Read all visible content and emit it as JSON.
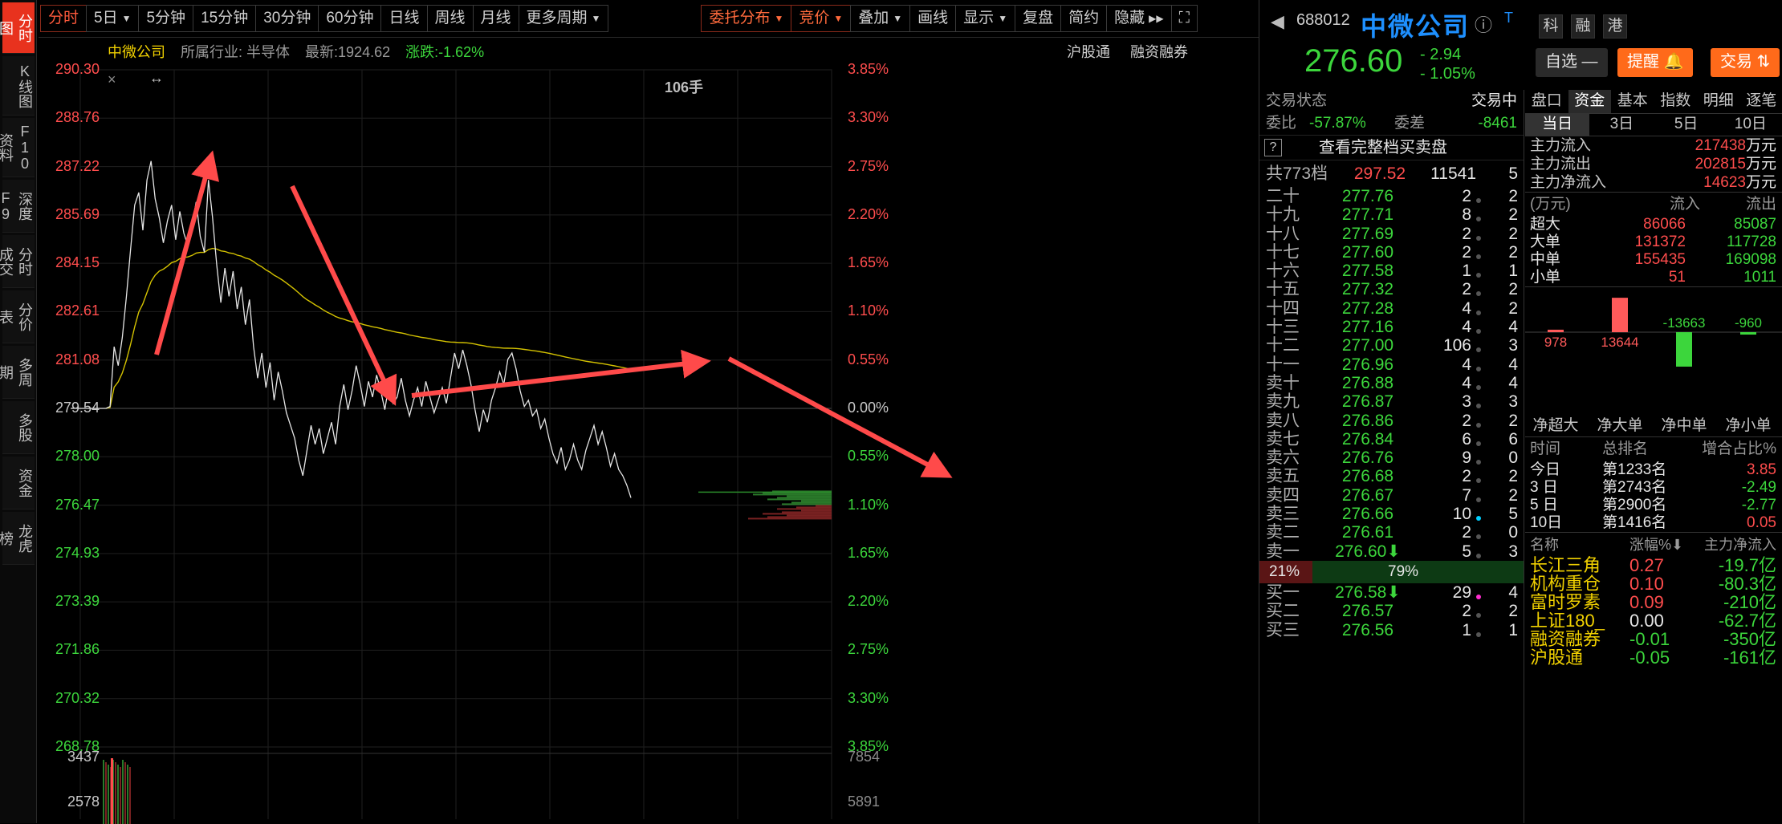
{
  "sidebar_tabs": [
    "分时图",
    "K线图",
    "F10资料",
    "深度F9",
    "分时成交",
    "分价表",
    "多周期",
    "多股",
    "资金",
    "龙虎榜"
  ],
  "toolbar": {
    "items": [
      "分时",
      "5日",
      "5分钟",
      "15分钟",
      "30分钟",
      "60分钟",
      "日线",
      "周线",
      "月线",
      "更多周期"
    ],
    "right_items": [
      "委托分布",
      "竞价",
      "叠加",
      "画线",
      "显示",
      "复盘",
      "简约",
      "隐藏"
    ]
  },
  "chart_header": {
    "stock": "中微公司",
    "industry": "所属行业: 半导体",
    "latest": "最新:1924.62",
    "change": "涨跌:-1.62%",
    "links": [
      "沪股通",
      "融资融券"
    ],
    "vol_label": "106手",
    "close_mark": "×",
    "drag_mark": "↔"
  },
  "chart_data": {
    "type": "line",
    "title": "",
    "ylim": [
      268.78,
      290.3
    ],
    "prev_close": 279.54,
    "price_ticks": [
      "290.30",
      "288.76",
      "287.22",
      "285.69",
      "284.15",
      "282.61",
      "281.08",
      "279.54",
      "278.00",
      "276.47",
      "274.93",
      "273.39",
      "271.86",
      "270.32",
      "268.78"
    ],
    "pct_ticks": [
      "3.85%",
      "3.30%",
      "2.75%",
      "2.20%",
      "1.65%",
      "1.10%",
      "0.55%",
      "0.00%",
      "0.55%",
      "1.10%",
      "1.65%",
      "2.20%",
      "2.75%",
      "3.30%",
      "3.85%"
    ],
    "vol_ticks_left": [
      "3437",
      "2578"
    ],
    "vol_ticks_right": [
      "7854",
      "5891"
    ],
    "price": [
      279.54,
      279.6,
      281.5,
      280.9,
      281.8,
      283.1,
      284.6,
      286.0,
      286.4,
      285.2,
      286.8,
      287.4,
      286.2,
      285.6,
      284.8,
      285.5,
      286.0,
      284.9,
      285.8,
      285.1,
      284.7,
      285.4,
      286.1,
      285.0,
      284.5,
      286.8,
      285.6,
      284.1,
      282.9,
      284.0,
      283.1,
      283.9,
      282.7,
      283.4,
      282.2,
      283.0,
      281.5,
      280.5,
      281.3,
      280.2,
      281.0,
      279.8,
      280.7,
      280.1,
      279.4,
      279.0,
      278.6,
      277.9,
      277.4,
      278.2,
      279.0,
      278.4,
      278.9,
      278.1,
      278.6,
      279.1,
      278.4,
      279.6,
      280.3,
      279.5,
      280.1,
      280.9,
      280.3,
      279.6,
      280.4,
      279.9,
      280.6,
      280.1,
      279.5,
      280.3,
      279.7,
      279.9,
      280.5,
      279.8,
      279.3,
      279.8,
      280.2,
      279.6,
      280.4,
      279.9,
      279.4,
      279.8,
      280.2,
      279.7,
      280.5,
      281.3,
      280.8,
      281.4,
      280.9,
      280.3,
      279.5,
      278.8,
      279.5,
      279.1,
      279.8,
      280.2,
      280.7,
      280.3,
      281.1,
      281.3,
      280.8,
      280.1,
      279.6,
      279.8,
      279.3,
      279.5,
      278.9,
      279.2,
      278.6,
      278.1,
      277.8,
      278.3,
      277.6,
      277.9,
      278.4,
      277.9,
      277.6,
      278.2,
      278.6,
      279.0,
      278.4,
      278.8,
      278.3,
      277.7,
      278.1,
      277.6,
      277.4,
      277.1,
      276.7
    ]
  },
  "right_panel": {
    "code": "688012",
    "name": "中微公司",
    "nav_prev": "◀",
    "info_icon": "ⓘ",
    "t_mark": "T",
    "tags": [
      "科",
      "融",
      "港"
    ],
    "price": "276.60",
    "change": "- 2.94",
    "change_pct": "- 1.05%",
    "btn_watch": "自选 —",
    "btn_alert": "提醒 🔔",
    "btn_trade": "交易 ⇅",
    "trade_status_label": "交易状态",
    "trade_status": "交易中",
    "weibi_label": "委比",
    "weibi": "-57.87%",
    "weicha_label": "委差",
    "weicha": "-8461",
    "view_full": "查看完整档买卖盘",
    "q_mark": "?",
    "total_label": "共773档",
    "total_price": "297.52",
    "total_vol": "11541",
    "total_cnt": "5",
    "asks": [
      {
        "label": "二十",
        "price": "277.76",
        "vol": "2",
        "cnt": "2"
      },
      {
        "label": "十九",
        "price": "277.71",
        "vol": "8",
        "cnt": "2"
      },
      {
        "label": "十八",
        "price": "277.69",
        "vol": "2",
        "cnt": "2"
      },
      {
        "label": "十七",
        "price": "277.60",
        "vol": "2",
        "cnt": "2"
      },
      {
        "label": "十六",
        "price": "277.58",
        "vol": "1",
        "cnt": "1"
      },
      {
        "label": "十五",
        "price": "277.32",
        "vol": "2",
        "cnt": "2"
      },
      {
        "label": "十四",
        "price": "277.28",
        "vol": "4",
        "cnt": "2"
      },
      {
        "label": "十三",
        "price": "277.16",
        "vol": "4",
        "cnt": "4"
      },
      {
        "label": "十二",
        "price": "277.00",
        "vol": "106",
        "cnt": "3"
      },
      {
        "label": "十一",
        "price": "276.96",
        "vol": "4",
        "cnt": "4"
      },
      {
        "label": "卖十",
        "price": "276.88",
        "vol": "4",
        "cnt": "4"
      },
      {
        "label": "卖九",
        "price": "276.87",
        "vol": "3",
        "cnt": "3"
      },
      {
        "label": "卖八",
        "price": "276.86",
        "vol": "2",
        "cnt": "2"
      },
      {
        "label": "卖七",
        "price": "276.84",
        "vol": "6",
        "cnt": "6"
      },
      {
        "label": "卖六",
        "price": "276.76",
        "vol": "9",
        "cnt": "0"
      },
      {
        "label": "卖五",
        "price": "276.68",
        "vol": "2",
        "cnt": "2"
      },
      {
        "label": "卖四",
        "price": "276.67",
        "vol": "7",
        "cnt": "2"
      },
      {
        "label": "卖三",
        "price": "276.66",
        "vol": "10",
        "cnt": "5"
      },
      {
        "label": "卖二",
        "price": "276.61",
        "vol": "2",
        "cnt": "0"
      },
      {
        "label": "卖一",
        "price": "276.60⬇",
        "vol": "5",
        "cnt": "3"
      }
    ],
    "split_red": "21%",
    "split_green": "79%",
    "bids": [
      {
        "label": "买一",
        "price": "276.58⬇",
        "vol": "29",
        "cnt": "4"
      },
      {
        "label": "买二",
        "price": "276.57",
        "vol": "2",
        "cnt": "2"
      },
      {
        "label": "买三",
        "price": "276.56",
        "vol": "1",
        "cnt": "1"
      }
    ],
    "tabs": [
      "盘口",
      "资金",
      "基本",
      "指数",
      "明细",
      "逐笔"
    ],
    "periods": [
      "当日",
      "3日",
      "5日",
      "10日"
    ],
    "flows": [
      {
        "k": "主力流入",
        "v": "217438",
        "u": "万元"
      },
      {
        "k": "主力流出",
        "v": "202815",
        "u": "万元"
      },
      {
        "k": "主力净流入",
        "v": "14623",
        "u": "万元"
      }
    ],
    "flow_hdr": [
      "(万元)",
      "流入",
      "流出"
    ],
    "flow_rows": [
      {
        "k": "超大",
        "in": "86066",
        "out": "85087"
      },
      {
        "k": "大单",
        "in": "131372",
        "out": "117728"
      },
      {
        "k": "中单",
        "in": "155435",
        "out": "169098"
      },
      {
        "k": "小单",
        "in": "51",
        "out": "1011"
      }
    ],
    "net_bars": [
      {
        "label": "净超大",
        "value": 978,
        "text": "978"
      },
      {
        "label": "净大单",
        "value": 13644,
        "text": "13644"
      },
      {
        "label": "净中单",
        "value": -13663,
        "text": "-13663"
      },
      {
        "label": "净小单",
        "value": -960,
        "text": "-960"
      }
    ],
    "rank_hdr": [
      "时间",
      "总排名",
      "增合占比%"
    ],
    "ranks": [
      {
        "t": "今日",
        "r": "第1233名",
        "p": "3.85"
      },
      {
        "t": "3 日",
        "r": "第2743名",
        "p": "-2.49"
      },
      {
        "t": "5 日",
        "r": "第2900名",
        "p": "-2.77"
      },
      {
        "t": "10日",
        "r": "第1416名",
        "p": "0.05"
      }
    ],
    "sec_hdr": [
      "名称",
      "涨幅%⬇",
      "主力净流入"
    ],
    "sectors": [
      {
        "n": "长江三角",
        "p": "0.27",
        "f": "-19.7亿"
      },
      {
        "n": "机构重仓",
        "p": "0.10",
        "f": "-80.3亿"
      },
      {
        "n": "富时罗素",
        "p": "0.09",
        "f": "-210亿"
      },
      {
        "n": "上证180_",
        "p": "0.00",
        "f": "-62.7亿"
      },
      {
        "n": "融资融券",
        "p": "-0.01",
        "f": "-350亿"
      },
      {
        "n": "沪股通",
        "p": "-0.05",
        "f": "-161亿"
      }
    ]
  },
  "colors": {
    "up": "#ff4d4d",
    "down": "#3cd63c",
    "avg": "#d4c200",
    "accent": "#e8321e",
    "name": "#1e90ff"
  }
}
